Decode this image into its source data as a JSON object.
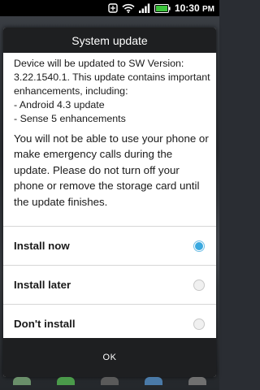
{
  "status_bar": {
    "time": "10:30",
    "ampm": "PM",
    "icons": [
      "notification-icon",
      "wifi-icon",
      "signal-icon",
      "battery-icon"
    ]
  },
  "dialog": {
    "title": "System update",
    "message_lines": [
      "Device will be updated to SW Version:",
      "3.22.1540.1. This update contains important",
      "enhancements, including:",
      "- Android 4.3 update",
      "- Sense 5 enhancements"
    ],
    "warning": "You will not be able to use your phone or make emergency calls during the update. Please do not turn off your phone or remove the storage card until the update finishes.",
    "options": [
      {
        "label": "Install now",
        "selected": true
      },
      {
        "label": "Install later",
        "selected": false
      },
      {
        "label": "Don't install",
        "selected": false
      }
    ],
    "ok_label": "OK"
  },
  "colors": {
    "accent": "#3aa9e0",
    "title_bar": "#1e1f21",
    "battery": "#3cc43c"
  }
}
